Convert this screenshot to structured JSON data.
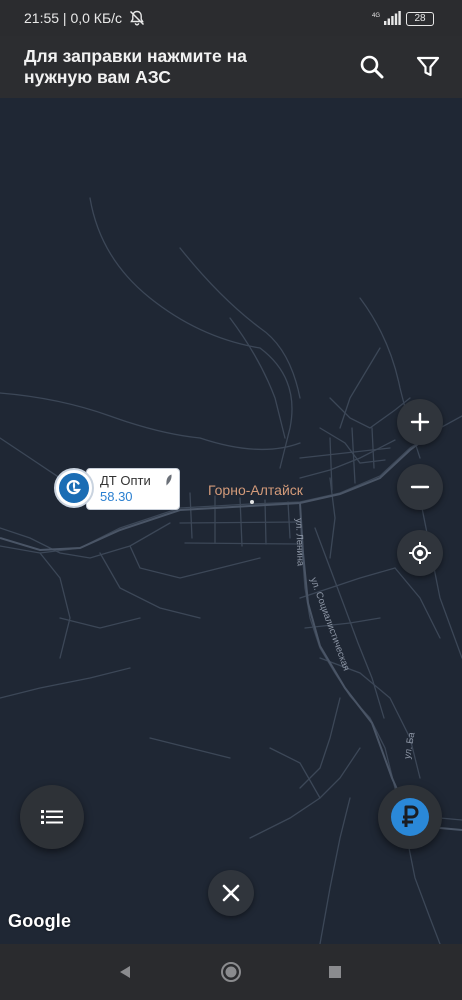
{
  "status_bar": {
    "time_speed": "21:55 | 0,0 КБ/с",
    "network": "4G",
    "battery": "28"
  },
  "header": {
    "title": "Для заправки нажмите на нужную вам АЗС",
    "search_icon": "search-icon",
    "filter_icon": "filter-icon"
  },
  "map": {
    "city_label": "Горно-Алтайск",
    "streets": [
      "ул. Ленина",
      "ул. Социалистическая",
      "ул. Ба"
    ],
    "station": {
      "fuel_name": "ДТ Опти",
      "price": "58.30",
      "brand_color": "#1b6db4"
    },
    "attribution": "Google"
  },
  "controls": {
    "zoom_in": "plus-icon",
    "zoom_out": "minus-icon",
    "my_location": "crosshair-icon",
    "list": "list-icon",
    "close": "close-icon",
    "price": "ruble-icon"
  },
  "colors": {
    "map_background": "#1f2734",
    "roads": "#3f4a5a",
    "city_label": "#d49b7a",
    "accent_blue": "#2a88d8"
  }
}
